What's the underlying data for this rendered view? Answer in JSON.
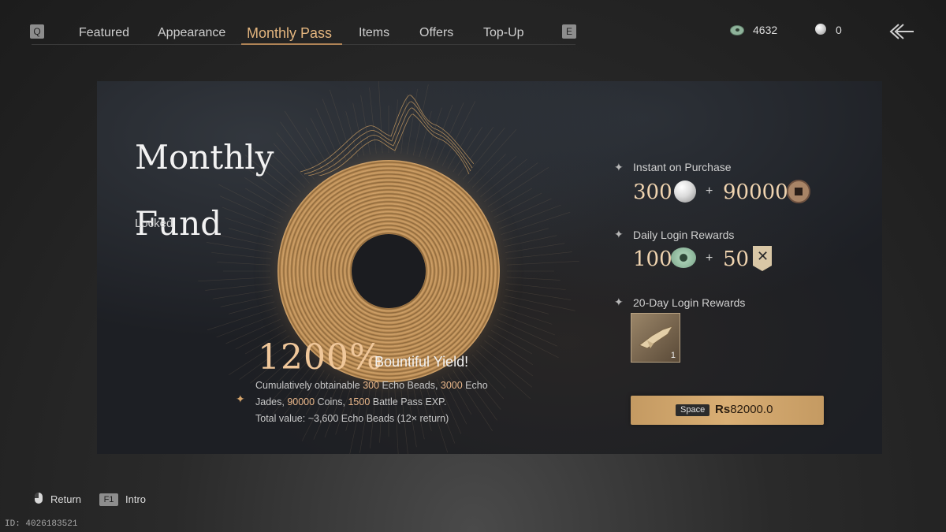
{
  "top_nav": {
    "left_key": "Q",
    "right_key": "E",
    "tabs": [
      {
        "label": "Featured"
      },
      {
        "label": "Appearance"
      },
      {
        "label": "Monthly Pass",
        "active": true
      },
      {
        "label": "Items"
      },
      {
        "label": "Offers"
      },
      {
        "label": "Top-Up"
      }
    ],
    "currencies": [
      {
        "icon": "jade-icon",
        "amount": "4632"
      },
      {
        "icon": "pearl-icon",
        "amount": "0"
      }
    ]
  },
  "panel": {
    "title_line1": "Monthly",
    "title_line2": "Fund",
    "status": "Locked",
    "yield_percent": "1200%",
    "yield_label": "Bountiful Yield!",
    "description": {
      "p1": "Cumulatively obtainable ",
      "v1": "300",
      "p2": " Echo Beads, ",
      "v2": "3000",
      "p3": " Echo Jades, ",
      "v3": "90000",
      "p4": " Coins, ",
      "v4": "1500",
      "p5": " Battle Pass EXP.",
      "line2": "Total value: ~3,600 Echo Beads (12× return)"
    },
    "rewards": {
      "instant": {
        "heading": "Instant on Purchase",
        "amount1": "300",
        "amount2": "90000",
        "plus": "+"
      },
      "daily": {
        "heading": "Daily Login Rewards",
        "amount1": "100",
        "amount2": "50",
        "plus": "+"
      },
      "twenty_day": {
        "heading": "20-Day Login Rewards",
        "item_count": "1"
      }
    },
    "purchase": {
      "key": "Space",
      "currency_prefix": "Rs",
      "price": "82000.0"
    }
  },
  "footer": {
    "return_label": "Return",
    "intro_key": "F1",
    "intro_label": "Intro",
    "uid": "ID: 4026183521"
  },
  "colors": {
    "accent_gold": "#e3b57e",
    "button_gold": "#d9ae74"
  }
}
